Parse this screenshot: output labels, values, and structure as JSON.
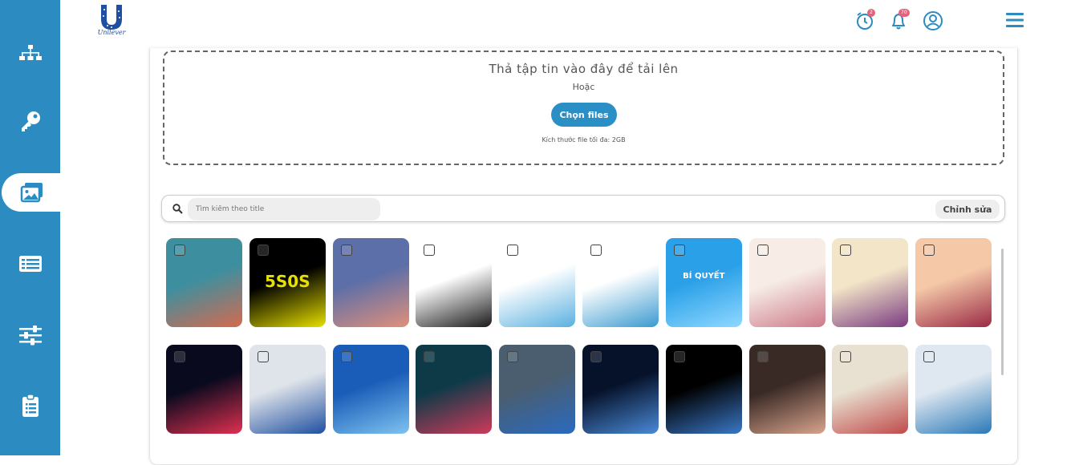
{
  "brand": {
    "logo_text": "Unilever",
    "accent": "#2c8bc0"
  },
  "sidebar": {
    "items": [
      {
        "icon": "sitemap-icon"
      },
      {
        "icon": "key-icon"
      },
      {
        "icon": "images-icon",
        "active": true
      },
      {
        "icon": "list-icon"
      },
      {
        "icon": "sliders-icon"
      },
      {
        "icon": "clipboard-icon"
      }
    ]
  },
  "header": {
    "alarm_badge": "2",
    "bell_badge": "70"
  },
  "upload": {
    "title": "Thả tập tin vào đây để tải lên",
    "or": "Hoặc",
    "button": "Chọn files",
    "note": "Kích thước file tối đa: 2GB"
  },
  "search": {
    "placeholder": "Tìm kiếm theo title",
    "edit_button": "Chỉnh sửa"
  },
  "gallery": {
    "images": [
      {
        "name": "alien-landscape",
        "colors": [
          "#3d8fa0",
          "#d56a4e"
        ]
      },
      {
        "name": "5s0s-logo",
        "text": "5S0S",
        "colors": [
          "#000000",
          "#e8e000"
        ]
      },
      {
        "name": "pink-sky",
        "colors": [
          "#5d6fa8",
          "#e0907a"
        ]
      },
      {
        "name": "water-dispenser",
        "colors": [
          "#ffffff",
          "#1a1a1a"
        ]
      },
      {
        "name": "water-infographic",
        "colors": [
          "#ffffff",
          "#5ab0e0"
        ]
      },
      {
        "name": "body-infographic",
        "colors": [
          "#ffffff",
          "#3a9ad0"
        ]
      },
      {
        "name": "bi-quyet-banner",
        "text": "BÍ QUYẾT",
        "colors": [
          "#2aa0e8",
          "#8fd8ff"
        ]
      },
      {
        "name": "cosmetics-banner",
        "colors": [
          "#f7ede6",
          "#cc7a8a"
        ]
      },
      {
        "name": "product-ad",
        "colors": [
          "#f3e6c8",
          "#7a3b80"
        ]
      },
      {
        "name": "woman-flowers",
        "colors": [
          "#f5c9a8",
          "#9a2a45"
        ]
      },
      {
        "name": "exhibition-booth",
        "colors": [
          "#0a0a1e",
          "#e03050"
        ]
      },
      {
        "name": "unilever-man",
        "colors": [
          "#dfe4ea",
          "#1f4fa0"
        ]
      },
      {
        "name": "robot-tech",
        "colors": [
          "#1a5db8",
          "#7fc3f0"
        ]
      },
      {
        "name": "stock-chart",
        "colors": [
          "#0e3a48",
          "#d03a5a"
        ]
      },
      {
        "name": "unilever-sign",
        "colors": [
          "#4a5e70",
          "#2a6ac0"
        ]
      },
      {
        "name": "globe-network",
        "colors": [
          "#06122a",
          "#4a8ad8"
        ]
      },
      {
        "name": "unilever-black",
        "colors": [
          "#000000",
          "#3a78c8"
        ]
      },
      {
        "name": "woman-portrait",
        "colors": [
          "#3a2a26",
          "#d9a48c"
        ]
      },
      {
        "name": "supermarket",
        "colors": [
          "#e8e0d0",
          "#c04a4a"
        ]
      },
      {
        "name": "presentation",
        "colors": [
          "#dfe8f0",
          "#2a78b8"
        ]
      }
    ]
  }
}
